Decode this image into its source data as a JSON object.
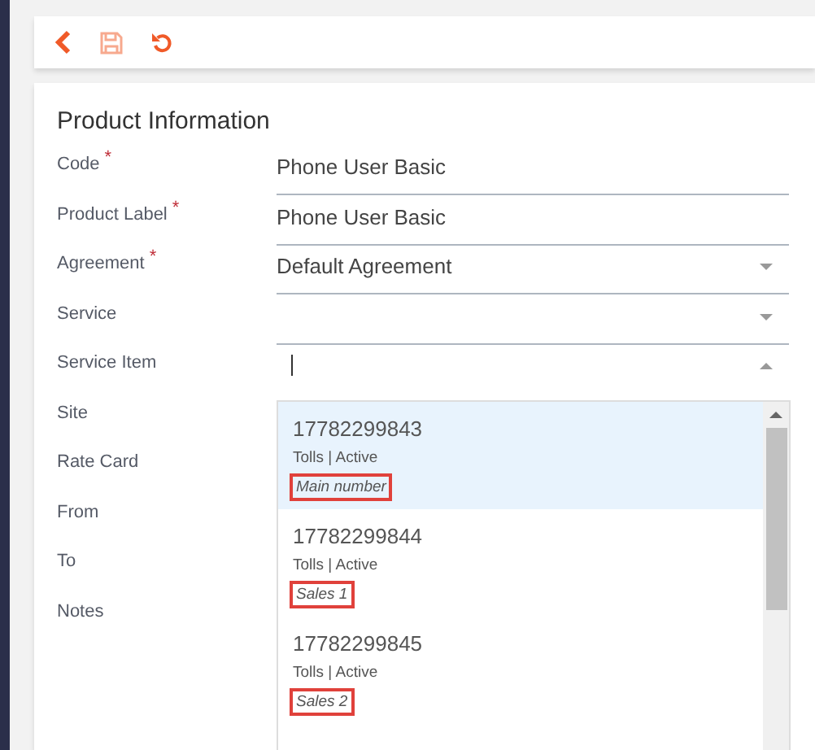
{
  "toolbar": {
    "buttons": [
      {
        "kind": "back",
        "disabled": false
      },
      {
        "kind": "save",
        "disabled": true
      },
      {
        "kind": "undo",
        "disabled": false
      }
    ]
  },
  "form": {
    "title": "Product Information",
    "fields": [
      {
        "label": "Code",
        "marker": "*",
        "kind": "text",
        "value": "Phone User Basic"
      },
      {
        "label": "Product Label",
        "marker": "*",
        "kind": "text",
        "value": "Phone User Basic"
      },
      {
        "label": "Agreement",
        "marker": "*",
        "kind": "select",
        "value": "Default Agreement",
        "expanded": false
      },
      {
        "label": "Service",
        "kind": "select",
        "expanded": false
      },
      {
        "label": "Service Item",
        "kind": "select",
        "expanded": true,
        "focused": true
      },
      {
        "label": "Site"
      },
      {
        "label": "Rate Card"
      },
      {
        "label": "From"
      },
      {
        "label": "To"
      },
      {
        "label": "Notes"
      }
    ]
  },
  "dropdown": {
    "items": [
      {
        "number": "17782299843",
        "status": "Tolls | Active",
        "note": "Main number",
        "selected": true,
        "marked": true
      },
      {
        "number": "17782299844",
        "status": "Tolls | Active",
        "note": "Sales 1",
        "selected": false,
        "marked": true
      },
      {
        "number": "17782299845",
        "status": "Tolls | Active",
        "note": "Sales 2",
        "selected": false,
        "marked": true
      }
    ]
  }
}
